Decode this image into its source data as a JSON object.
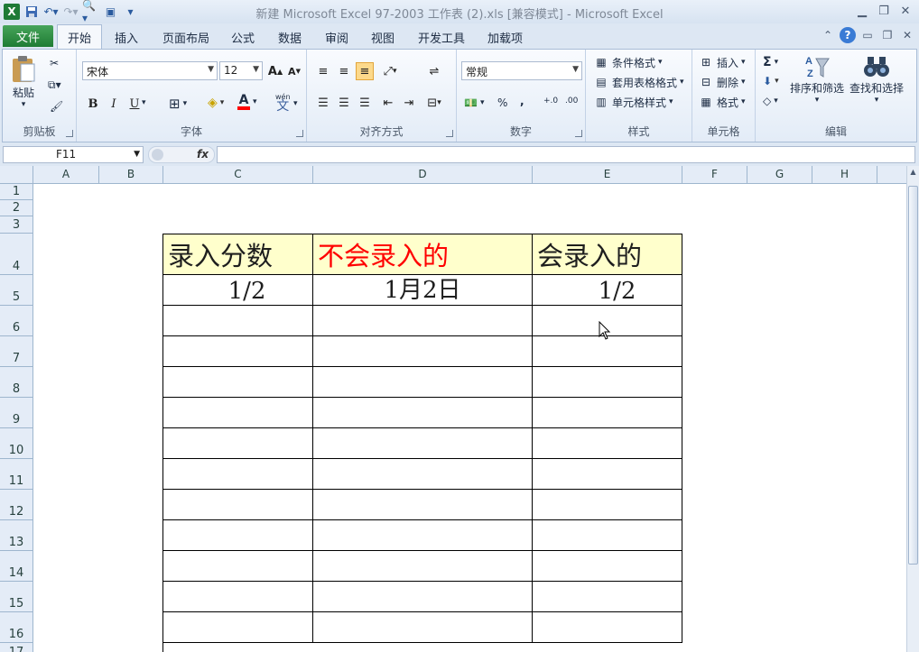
{
  "window": {
    "title": "新建 Microsoft Excel 97-2003 工作表 (2).xls  [兼容模式]  -  Microsoft Excel"
  },
  "tabs": {
    "file": "文件",
    "items": [
      "开始",
      "插入",
      "页面布局",
      "公式",
      "数据",
      "审阅",
      "视图",
      "开发工具",
      "加载项"
    ],
    "active": "开始"
  },
  "ribbon": {
    "clipboard": {
      "label": "剪贴板",
      "paste": "粘贴"
    },
    "font": {
      "label": "字体",
      "name": "宋体",
      "size": "12",
      "bold": "B",
      "italic": "I",
      "underline": "U",
      "grow": "A",
      "shrink": "A",
      "wen": "wén"
    },
    "alignment": {
      "label": "对齐方式"
    },
    "number": {
      "label": "数字",
      "format": "常规",
      "percent": "%",
      "comma": ",",
      "inc_decimal": "+.0",
      "dec_decimal": ".00"
    },
    "styles": {
      "label": "样式",
      "conditional": "条件格式",
      "table": "套用表格格式",
      "cell": "单元格样式"
    },
    "cells": {
      "label": "单元格",
      "insert": "插入",
      "delete": "删除",
      "format": "格式"
    },
    "editing": {
      "label": "编辑",
      "sum": "Σ",
      "sort": "排序和筛选",
      "find": "查找和选择"
    }
  },
  "formula_bar": {
    "name_box": "F11",
    "fx": "fx",
    "content": ""
  },
  "columns": [
    "A",
    "B",
    "C",
    "D",
    "E",
    "F",
    "G",
    "H"
  ],
  "rows": [
    "1",
    "2",
    "3",
    "4",
    "5",
    "6",
    "7",
    "8",
    "9",
    "10",
    "11",
    "12",
    "13",
    "14",
    "15",
    "16",
    "17"
  ],
  "table": {
    "headers": [
      "录入分数",
      "不会录入的",
      "会录入的"
    ],
    "values": [
      "1/2",
      "1月2日",
      "1/2"
    ]
  },
  "colors": {
    "header_fill": "#ffffcc",
    "red_text": "#ff0000",
    "file_tab": "#2b8a3e"
  }
}
